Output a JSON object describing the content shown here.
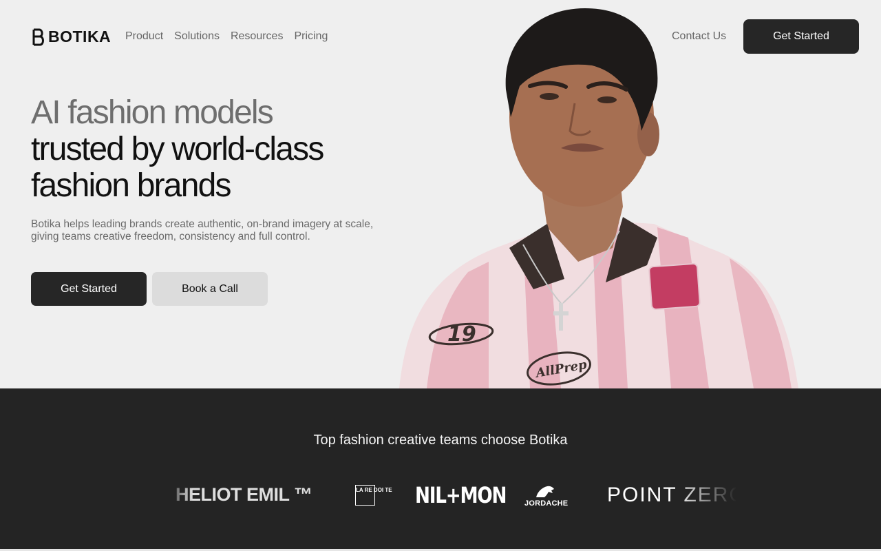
{
  "nav": {
    "logo_text": "BOTIKA",
    "links": [
      "Product",
      "Solutions",
      "Resources",
      "Pricing"
    ],
    "contact": "Contact Us",
    "cta": "Get Started"
  },
  "hero": {
    "headline_line1": "AI fashion models",
    "headline_line2": "trusted by world-class",
    "headline_line3": "fashion brands",
    "subtitle": "Botika helps leading brands create authentic, on-brand imagery at scale, giving teams creative freedom, consistency and full control.",
    "primary_button": "Get Started",
    "secondary_button": "Book a Call",
    "image_text": {
      "number": "19",
      "chest_badge": "AllPrep"
    }
  },
  "brands": {
    "title": "Top fashion creative teams choose Botika",
    "logos": [
      {
        "name": "HELIOT EMIL ™"
      },
      {
        "name": "LA RE DOI TE"
      },
      {
        "name": "NIL+MON"
      },
      {
        "name": "JORDACHE"
      },
      {
        "name": "POINT ZERO"
      }
    ]
  },
  "colors": {
    "background": "#efefef",
    "dark": "#262626",
    "band": "#242424",
    "muted_text": "#6e6e6e"
  }
}
